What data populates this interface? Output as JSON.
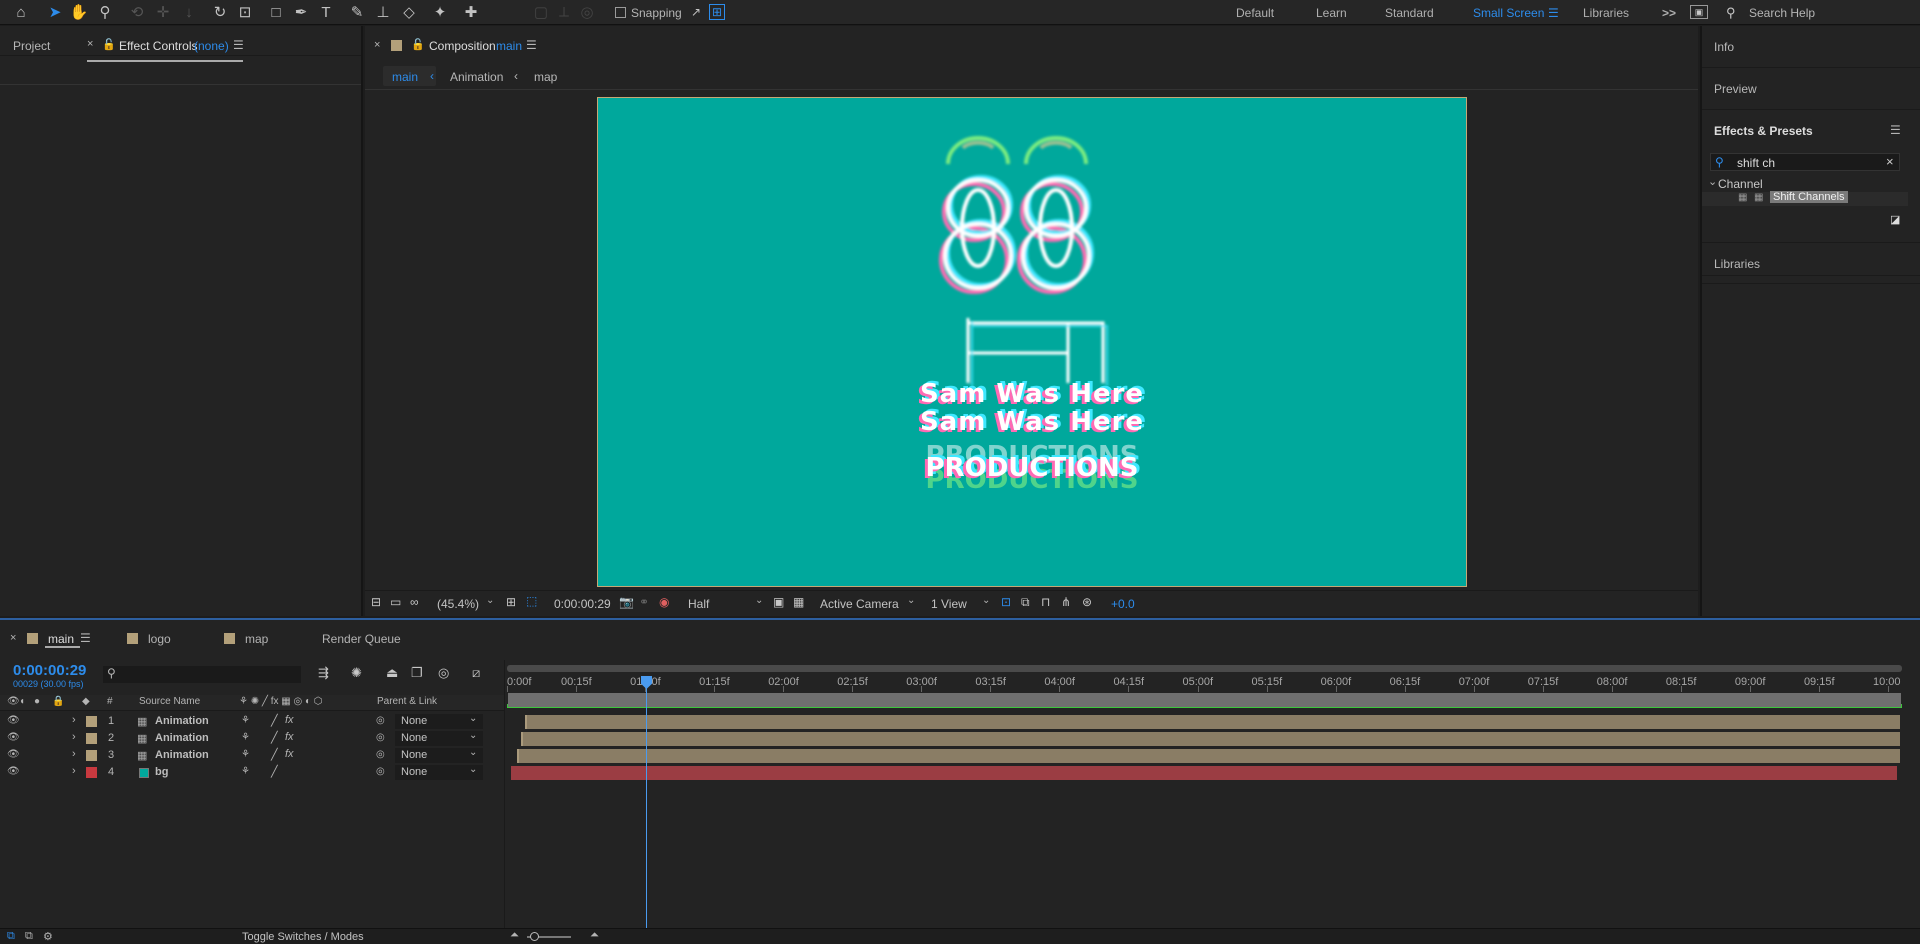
{
  "toolbar": {
    "snapping_label": "Snapping",
    "workspaces": [
      "Default",
      "Learn",
      "Standard",
      "Small Screen",
      "Libraries"
    ],
    "active_workspace": "Small Screen",
    "search_placeholder": "Search Help",
    "overflow_symbol": ">>"
  },
  "left_panel": {
    "tab_project": "Project",
    "tab_effect_controls": "Effect Controls",
    "effect_controls_target": "(none)"
  },
  "comp_panel": {
    "tab_prefix": "Composition",
    "tab_name": "main",
    "breadcrumbs": [
      "main",
      "Animation",
      "map"
    ],
    "footer": {
      "magnification": "(45.4%)",
      "timecode": "0:00:00:29",
      "resolution": "Half",
      "camera": "Active Camera",
      "views": "1 View",
      "exposure": "+0.0"
    },
    "artwork": {
      "line1": "Sam Was Here",
      "line2": "PRODUCTIONS"
    }
  },
  "right_panel": {
    "info_label": "Info",
    "preview_label": "Preview",
    "effects_presets_label": "Effects & Presets",
    "search_value": "shift ch",
    "category": "Channel",
    "result_item": "Shift Channels",
    "libraries_label": "Libraries"
  },
  "timeline": {
    "tabs": [
      {
        "label": "main",
        "active": true
      },
      {
        "label": "logo",
        "active": false
      },
      {
        "label": "map",
        "active": false
      },
      {
        "label": "Render Queue",
        "active": false
      }
    ],
    "current_time": "0:00:00:29",
    "frame_info": "00029 (30.00 fps)",
    "col_num": "#",
    "col_source_name": "Source Name",
    "col_parent": "Parent & Link",
    "layers": [
      {
        "index": "1",
        "name": "Animation",
        "parent": "None",
        "label_color": "#b3a07a"
      },
      {
        "index": "2",
        "name": "Animation",
        "parent": "None",
        "label_color": "#b3a07a"
      },
      {
        "index": "3",
        "name": "Animation",
        "parent": "None",
        "label_color": "#b3a07a"
      },
      {
        "index": "4",
        "name": "bg",
        "parent": "None",
        "label_color": "#c8393f"
      }
    ],
    "ruler_ticks": [
      "0:00f",
      "00:15f",
      "01:00f",
      "01:15f",
      "02:00f",
      "02:15f",
      "03:00f",
      "03:15f",
      "04:00f",
      "04:15f",
      "05:00f",
      "05:15f",
      "06:00f",
      "06:15f",
      "07:00f",
      "07:15f",
      "08:00f",
      "08:15f",
      "09:00f",
      "09:15f",
      "10:00"
    ],
    "toggle_label": "Toggle Switches / Modes"
  },
  "colors": {
    "accent": "#2d8ceb",
    "comp_background": "#00a89c",
    "animation_bar": "#8a7d65",
    "bg_bar": "#9b3d43"
  }
}
